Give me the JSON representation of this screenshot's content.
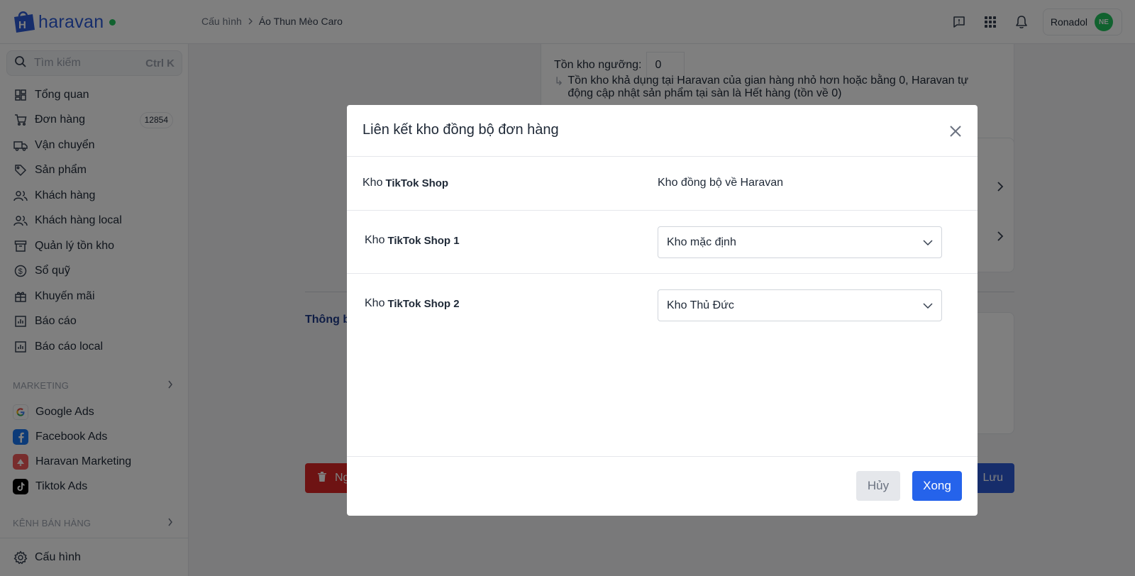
{
  "header": {
    "brand": "haravan",
    "breadcrumb": [
      "Cấu hình",
      "Áo Thun Mèo Caro"
    ],
    "user": {
      "name": "Ronadol",
      "initials": "NE"
    },
    "icons": [
      "feedback-icon",
      "apps-grid-icon",
      "bell-icon"
    ]
  },
  "sidebar": {
    "search": {
      "placeholder": "Tìm kiếm",
      "shortcut": "Ctrl K"
    },
    "items": [
      {
        "label": "Tổng quan",
        "icon": "dashboard-icon"
      },
      {
        "label": "Đơn hàng",
        "icon": "cart-icon",
        "badge": "12854"
      },
      {
        "label": "Vận chuyển",
        "icon": "truck-icon"
      },
      {
        "label": "Sản phẩm",
        "icon": "tag-icon"
      },
      {
        "label": "Khách hàng",
        "icon": "users-icon"
      },
      {
        "label": "Khách hàng local",
        "icon": "users-icon"
      },
      {
        "label": "Quản lý tồn kho",
        "icon": "archive-icon"
      },
      {
        "label": "Sổ quỹ",
        "icon": "dollar-icon"
      },
      {
        "label": "Khuyến mãi",
        "icon": "gift-icon"
      },
      {
        "label": "Báo cáo",
        "icon": "chart-icon"
      },
      {
        "label": "Báo cáo local",
        "icon": "chart-icon"
      }
    ],
    "marketing_title": "MARKETING",
    "marketing": [
      {
        "label": "Google Ads",
        "icon": "google-icon"
      },
      {
        "label": "Facebook Ads",
        "icon": "facebook-icon"
      },
      {
        "label": "Haravan Marketing",
        "icon": "haravan-marketing-icon"
      },
      {
        "label": "Tiktok Ads",
        "icon": "tiktok-icon"
      }
    ],
    "channels_title": "KÊNH BÁN HÀNG",
    "config": "Cấu hình"
  },
  "background": {
    "threshold_label": "Tồn kho ngưỡng:",
    "threshold_value": "0",
    "threshold_note": "Tồn kho khả dụng tại Haravan của gian hàng nhỏ hơn hoặc bằng 0, Haravan tự động cập nhật sản phẩm tại sàn là Hết hàng (tồn về 0)",
    "section_partial": "Thông b",
    "delete_partial": "Ng",
    "save_label": "Lưu"
  },
  "modal": {
    "title": "Liên kết kho đồng bộ đơn hàng",
    "col_left_prefix": "Kho",
    "col_left_bold": "TikTok Shop",
    "col_right": "Kho đồng bộ về Haravan",
    "rows": [
      {
        "prefix": "Kho",
        "shop": "TikTok Shop 1",
        "warehouse": "Kho mặc định"
      },
      {
        "prefix": "Kho",
        "shop": "TikTok Shop 2",
        "warehouse": "Kho Thủ Đức"
      }
    ],
    "cancel_label": "Hủy",
    "done_label": "Xong"
  },
  "colors": {
    "brand": "#2d5bd7",
    "primary_button": "#2563eb",
    "danger": "#dc2626",
    "status_green": "#22c55e"
  }
}
